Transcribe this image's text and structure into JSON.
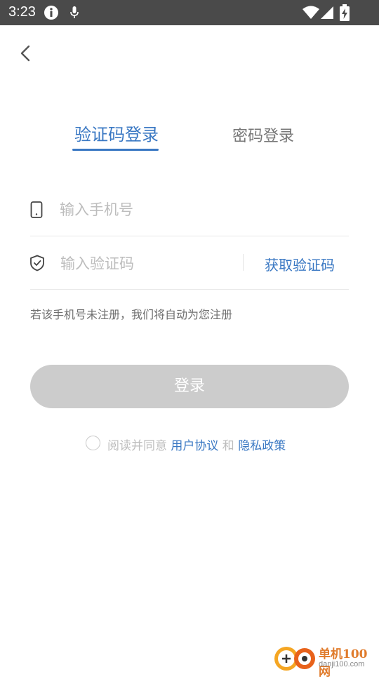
{
  "status_bar": {
    "time": "3:23",
    "icons": [
      "info-icon",
      "mic-icon",
      "wifi-icon",
      "signal-icon",
      "battery-charging-icon"
    ]
  },
  "nav": {
    "back_icon": "chevron-left-icon"
  },
  "tabs": [
    {
      "label": "验证码登录",
      "active": true
    },
    {
      "label": "密码登录",
      "active": false
    }
  ],
  "form": {
    "phone": {
      "icon": "phone-icon",
      "placeholder": "输入手机号",
      "value": ""
    },
    "code": {
      "icon": "shield-icon",
      "placeholder": "输入验证码",
      "value": ""
    },
    "get_code_label": "获取验证码",
    "hint": "若该手机号未注册，我们将自动为您注册"
  },
  "login_button": {
    "label": "登录",
    "enabled": false
  },
  "agreement": {
    "checked": false,
    "prefix": "阅读并同意 ",
    "user_agreement": "用户协议",
    "and": " 和 ",
    "privacy_policy": "隐私政策"
  },
  "watermark": {
    "name": "单机100网",
    "url": "danji100.com"
  },
  "colors": {
    "accent": "#3a78c3",
    "status_bar": "#4a4a4a",
    "disabled_button": "#cccccc",
    "watermark": "#e07b2b"
  }
}
